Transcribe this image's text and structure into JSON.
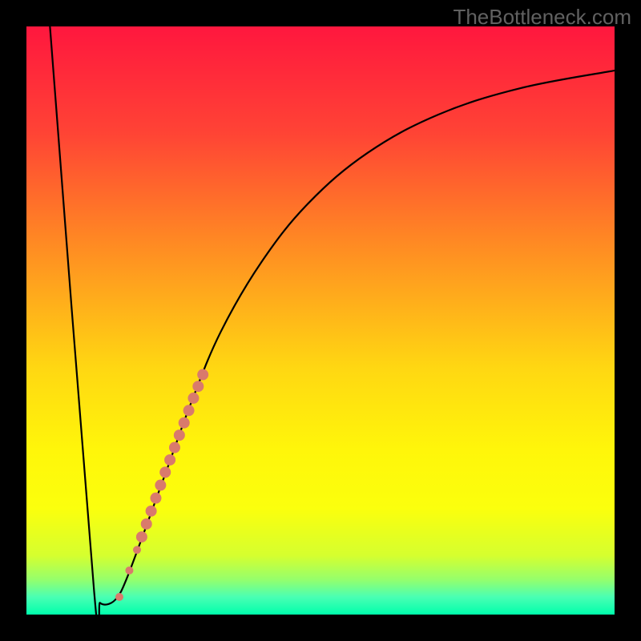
{
  "watermark": "TheBottleneck.com",
  "chart_data": {
    "type": "line",
    "title": "",
    "xlabel": "",
    "ylabel": "",
    "xlim": [
      0,
      100
    ],
    "ylim": [
      0,
      100
    ],
    "background_gradient": {
      "stops": [
        {
          "offset": 0.0,
          "color": "#ff173e"
        },
        {
          "offset": 0.18,
          "color": "#ff4335"
        },
        {
          "offset": 0.38,
          "color": "#ff8e22"
        },
        {
          "offset": 0.58,
          "color": "#ffd712"
        },
        {
          "offset": 0.72,
          "color": "#fff60a"
        },
        {
          "offset": 0.82,
          "color": "#fbff0d"
        },
        {
          "offset": 0.9,
          "color": "#d5ff2f"
        },
        {
          "offset": 0.94,
          "color": "#96ff6b"
        },
        {
          "offset": 0.97,
          "color": "#4affb3"
        },
        {
          "offset": 1.0,
          "color": "#00ffac"
        }
      ]
    },
    "series": [
      {
        "name": "bottleneck-curve",
        "stroke": "#000000",
        "stroke_width": 2.2,
        "points": [
          {
            "x": 4.0,
            "y": 100.0
          },
          {
            "x": 11.5,
            "y": 4.0
          },
          {
            "x": 12.5,
            "y": 2.0
          },
          {
            "x": 14.0,
            "y": 1.8
          },
          {
            "x": 15.5,
            "y": 3.0
          },
          {
            "x": 17.0,
            "y": 6.0
          },
          {
            "x": 20.0,
            "y": 14.0
          },
          {
            "x": 24.0,
            "y": 25.0
          },
          {
            "x": 28.0,
            "y": 36.0
          },
          {
            "x": 33.0,
            "y": 48.0
          },
          {
            "x": 40.0,
            "y": 60.0
          },
          {
            "x": 48.0,
            "y": 70.0
          },
          {
            "x": 58.0,
            "y": 78.5
          },
          {
            "x": 70.0,
            "y": 85.0
          },
          {
            "x": 84.0,
            "y": 89.5
          },
          {
            "x": 100.0,
            "y": 92.5
          }
        ]
      }
    ],
    "markers": {
      "name": "highlight-segment",
      "fill": "#d97a6c",
      "points": [
        {
          "x": 15.8,
          "y": 3.0,
          "r": 5
        },
        {
          "x": 17.5,
          "y": 7.5,
          "r": 5
        },
        {
          "x": 18.8,
          "y": 11.0,
          "r": 5
        },
        {
          "x": 19.6,
          "y": 13.2,
          "r": 7
        },
        {
          "x": 20.4,
          "y": 15.4,
          "r": 7
        },
        {
          "x": 21.2,
          "y": 17.6,
          "r": 7
        },
        {
          "x": 22.0,
          "y": 19.8,
          "r": 7
        },
        {
          "x": 22.8,
          "y": 22.0,
          "r": 7
        },
        {
          "x": 23.6,
          "y": 24.2,
          "r": 7
        },
        {
          "x": 24.4,
          "y": 26.3,
          "r": 7
        },
        {
          "x": 25.2,
          "y": 28.4,
          "r": 7
        },
        {
          "x": 26.0,
          "y": 30.5,
          "r": 7
        },
        {
          "x": 26.8,
          "y": 32.6,
          "r": 7
        },
        {
          "x": 27.6,
          "y": 34.7,
          "r": 7
        },
        {
          "x": 28.4,
          "y": 36.8,
          "r": 7
        },
        {
          "x": 29.2,
          "y": 38.8,
          "r": 7
        },
        {
          "x": 30.0,
          "y": 40.8,
          "r": 7
        }
      ]
    }
  }
}
